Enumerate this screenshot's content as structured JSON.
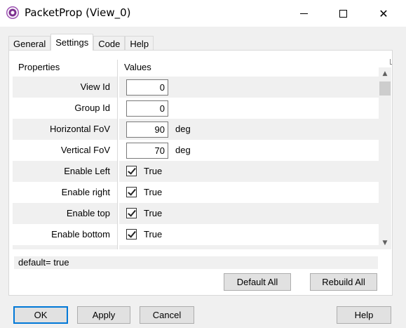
{
  "window": {
    "title": "PacketProp (View_0)",
    "minimize_glyph": "—",
    "maximize_glyph": "☐",
    "close_glyph": "✕"
  },
  "tabs": [
    {
      "label": "General"
    },
    {
      "label": "Settings"
    },
    {
      "label": "Code"
    },
    {
      "label": "Help"
    }
  ],
  "active_tab": "Settings",
  "grid": {
    "header_properties": "Properties",
    "header_values": "Values",
    "rows": [
      {
        "label": "View Id",
        "value": "0",
        "unit": ""
      },
      {
        "label": "Group Id",
        "value": "0",
        "unit": ""
      },
      {
        "label": "Horizontal FoV",
        "value": "90",
        "unit": "deg"
      },
      {
        "label": "Vertical FoV",
        "value": "70",
        "unit": "deg"
      },
      {
        "label": "Enable Left",
        "checked": true,
        "text": "True"
      },
      {
        "label": "Enable right",
        "checked": true,
        "text": "True"
      },
      {
        "label": "Enable top",
        "checked": true,
        "text": "True"
      },
      {
        "label": "Enable bottom",
        "checked": true,
        "text": "True"
      }
    ]
  },
  "status": "default= true",
  "buttons": {
    "default_all": "Default All",
    "rebuild_all": "Rebuild All",
    "ok": "OK",
    "apply": "Apply",
    "cancel": "Cancel",
    "help": "Help"
  },
  "scrollbar": {
    "up_glyph": "▲",
    "down_glyph": "▼"
  },
  "colors": {
    "accent": "#0078d7",
    "alt_row": "#f0f0f0"
  }
}
